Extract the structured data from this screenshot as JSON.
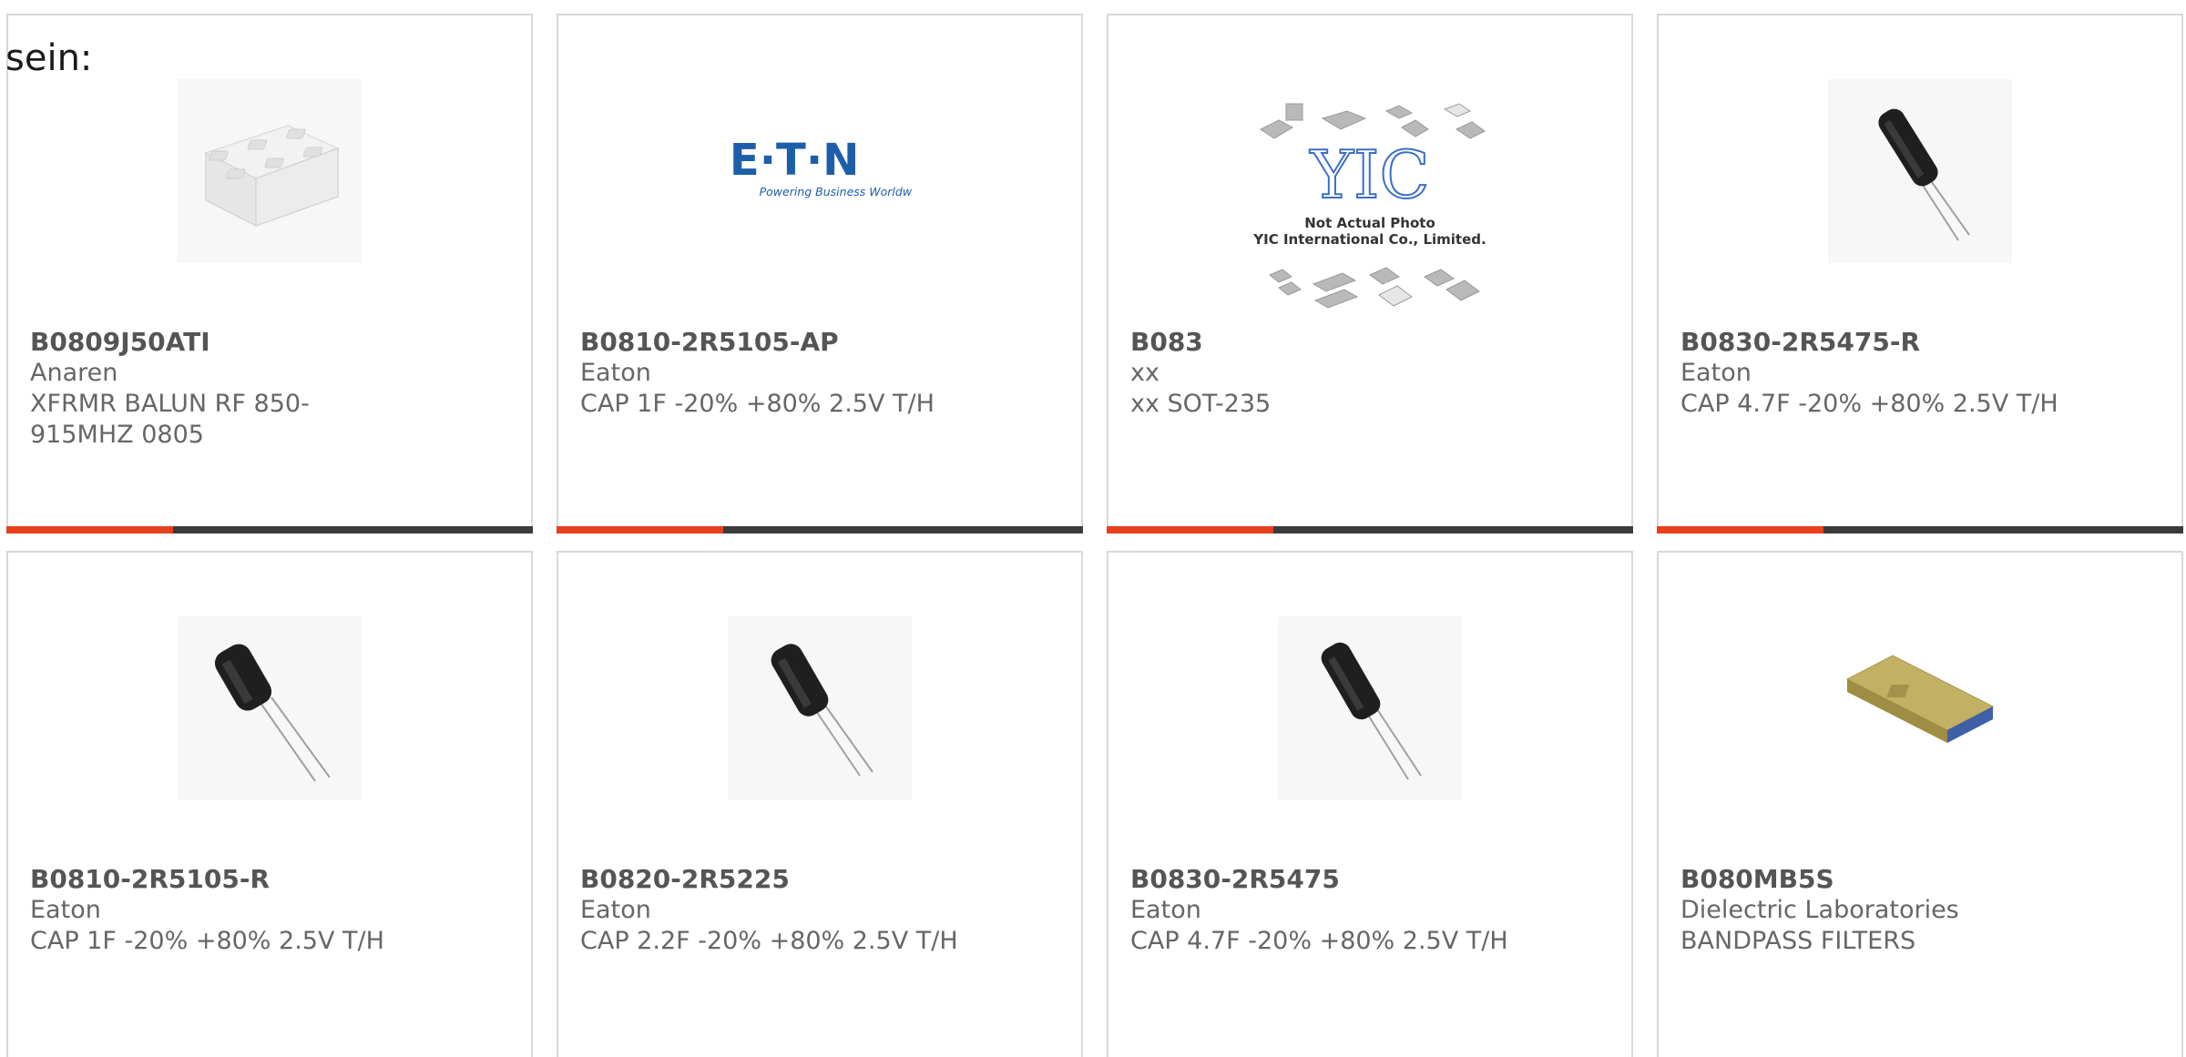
{
  "prefix_text": "sein:",
  "colors": {
    "accent": "#e8401c",
    "bar": "#3b3b3b",
    "border": "#d9d9d9",
    "eaton_blue": "#1d5eaa"
  },
  "cards": [
    {
      "part_number": "B0809J50ATI",
      "manufacturer": "Anaren",
      "description": "XFRMR BALUN RF 850-915MHZ 0805",
      "image": "balun-chip-image"
    },
    {
      "part_number": "B0810-2R5105-AP",
      "manufacturer": "Eaton",
      "description": "CAP 1F -20% +80% 2.5V T/H",
      "image": "eaton-logo-image",
      "logo_text": "E∙T∙N",
      "logo_tagline": "Powering Business Worldwide"
    },
    {
      "part_number": "B083",
      "manufacturer": "xx",
      "description": "xx SOT-235",
      "image": "yic-placeholder-image",
      "logo_text": "YIC",
      "note_line1": "Not Actual Photo",
      "note_line2": "YIC International Co., Limited."
    },
    {
      "part_number": "B0830-2R5475-R",
      "manufacturer": "Eaton",
      "description": "CAP 4.7F -20% +80% 2.5V T/H",
      "image": "capacitor-image"
    },
    {
      "part_number": "B0810-2R5105-R",
      "manufacturer": "Eaton",
      "description": "CAP 1F -20% +80% 2.5V T/H",
      "image": "capacitor-image"
    },
    {
      "part_number": "B0820-2R5225",
      "manufacturer": "Eaton",
      "description": "CAP 2.2F -20% +80% 2.5V T/H",
      "image": "capacitor-image"
    },
    {
      "part_number": "B0830-2R5475",
      "manufacturer": "Eaton",
      "description": "CAP 4.7F -20% +80% 2.5V T/H",
      "image": "capacitor-image"
    },
    {
      "part_number": "B080MB5S",
      "manufacturer": "Dielectric Laboratories",
      "description": "BANDPASS FILTERS",
      "image": "filter-module-image"
    }
  ]
}
